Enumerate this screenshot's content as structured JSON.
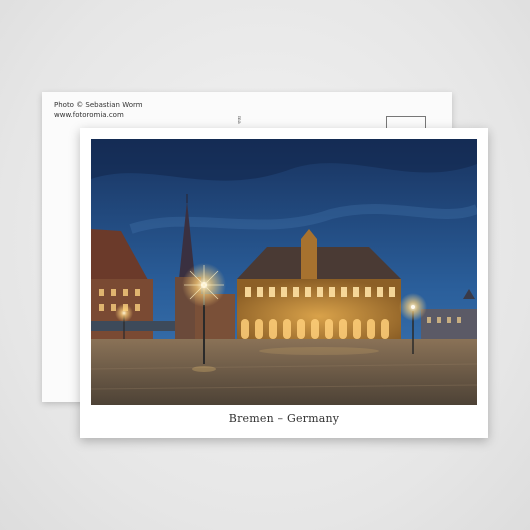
{
  "back_card": {
    "credit_line1": "Photo © Sebastian Worm",
    "credit_line2": "www.fotoromia.com",
    "vertical_text": "ma"
  },
  "front_card": {
    "caption": "Bremen – Germany",
    "photo_description_icon": "bremen-townhall-photo"
  },
  "colors": {
    "sky_top": "#1b3a6b",
    "sky_bottom": "#2e6aa8",
    "building": "#a8732e",
    "lights": "#ffd27a",
    "pavement": "#6a5a48"
  }
}
